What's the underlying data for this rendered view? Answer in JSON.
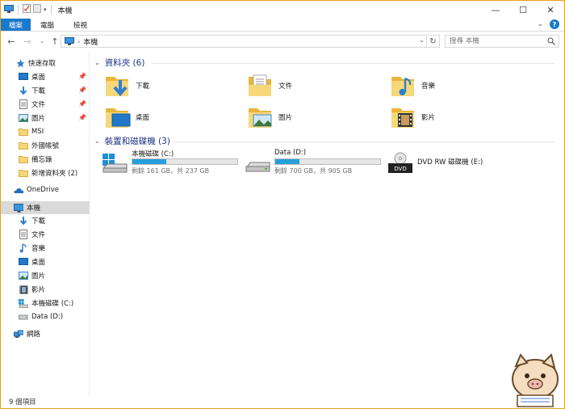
{
  "window": {
    "title": "本機"
  },
  "ribbon": {
    "tabs": [
      {
        "label": "檔案"
      },
      {
        "label": "電腦"
      },
      {
        "label": "檢視"
      }
    ]
  },
  "address": {
    "path": "本機",
    "search_placeholder": "搜尋 本機"
  },
  "sidebar": {
    "quick_access": "快速存取",
    "items": [
      {
        "label": "桌面",
        "icon": "desktop-icon",
        "pinned": true
      },
      {
        "label": "下載",
        "icon": "download-icon",
        "pinned": true
      },
      {
        "label": "文件",
        "icon": "document-icon",
        "pinned": true
      },
      {
        "label": "圖片",
        "icon": "picture-icon",
        "pinned": true
      },
      {
        "label": "MSI",
        "icon": "folder-icon"
      },
      {
        "label": "外國帳號",
        "icon": "folder-icon"
      },
      {
        "label": "備忘錄",
        "icon": "folder-icon"
      },
      {
        "label": "新增資料夾 (2)",
        "icon": "folder-icon"
      }
    ],
    "onedrive": "OneDrive",
    "this_pc": "本機",
    "pc_items": [
      {
        "label": "下載",
        "icon": "download-icon"
      },
      {
        "label": "文件",
        "icon": "document-icon"
      },
      {
        "label": "音樂",
        "icon": "music-icon"
      },
      {
        "label": "桌面",
        "icon": "desktop-icon"
      },
      {
        "label": "圖片",
        "icon": "picture-icon"
      },
      {
        "label": "影片",
        "icon": "video-icon"
      },
      {
        "label": "本機磁碟 (C:)",
        "icon": "drive-icon"
      },
      {
        "label": "Data (D:)",
        "icon": "drive-icon"
      }
    ],
    "network": "網路"
  },
  "main": {
    "folders_header": "資料夾 (6)",
    "folders": [
      {
        "label": "下載",
        "icon": "download-folder-icon"
      },
      {
        "label": "文件",
        "icon": "document-folder-icon"
      },
      {
        "label": "音樂",
        "icon": "music-folder-icon"
      },
      {
        "label": "桌面",
        "icon": "desktop-folder-icon"
      },
      {
        "label": "圖片",
        "icon": "picture-folder-icon"
      },
      {
        "label": "影片",
        "icon": "video-folder-icon"
      }
    ],
    "devices_header": "裝置和磁碟機 (3)",
    "drives": [
      {
        "label": "本機磁碟 (C:)",
        "info": "剩餘 161 GB，共 237 GB",
        "used_fraction": 0.32
      },
      {
        "label": "Data (D:)",
        "info": "剩餘 700 GB，共 905 GB",
        "used_fraction": 0.23
      }
    ],
    "dvd": {
      "label": "DVD RW 磁碟機 (E:)",
      "badge": "DVD"
    }
  },
  "status": {
    "count": "9 個項目"
  },
  "colors": {
    "accent": "#1979ca",
    "folder": "#f6d77a",
    "bar_fill": "#26a0da",
    "window_border": "#e3a21a"
  }
}
